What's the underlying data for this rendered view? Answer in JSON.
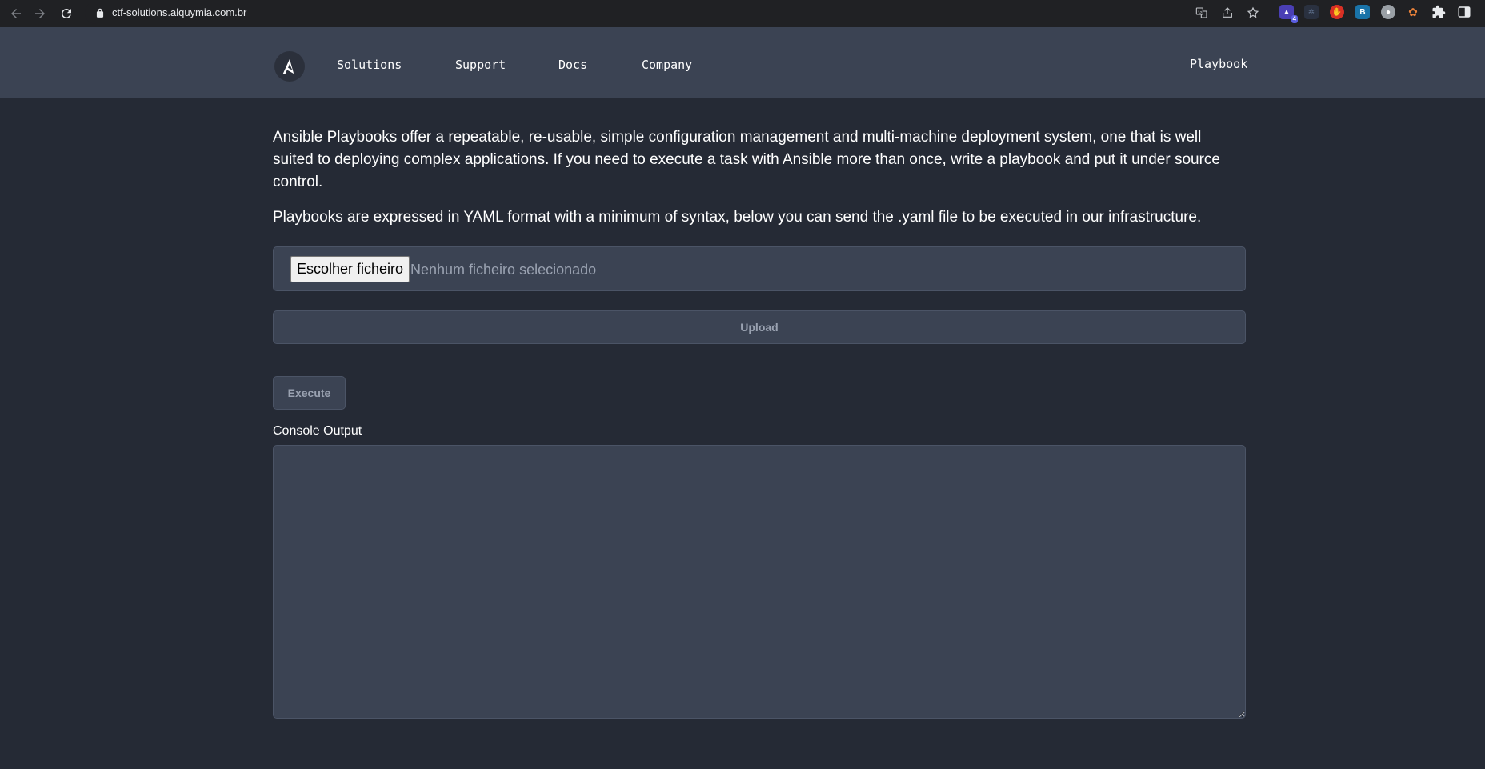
{
  "browser": {
    "url": "ctf-solutions.alquymia.com.br",
    "extension_badge": "4"
  },
  "header": {
    "logo_letter": "A",
    "nav": {
      "solutions": "Solutions",
      "support": "Support",
      "docs": "Docs",
      "company": "Company",
      "playbook": "Playbook"
    }
  },
  "main": {
    "intro_paragraph": "Ansible Playbooks offer a repeatable, re-usable, simple configuration management and multi-machine deployment system, one that is well suited to deploying complex applications. If you need to execute a task with Ansible more than once, write a playbook and put it under source control.",
    "yaml_paragraph": "Playbooks are expressed in YAML format with a minimum of syntax, below you can send the .yaml file to be executed in our infrastructure.",
    "file_input": {
      "button_label": "Escolher ficheiro",
      "status": "Nenhum ficheiro selecionado"
    },
    "upload_label": "Upload",
    "execute_label": "Execute",
    "console_label": "Console Output",
    "console_value": ""
  },
  "colors": {
    "page_bg": "#252a35",
    "header_bg": "#3b4353",
    "field_bg": "#3b4353",
    "muted_text": "#9aa2b1"
  }
}
